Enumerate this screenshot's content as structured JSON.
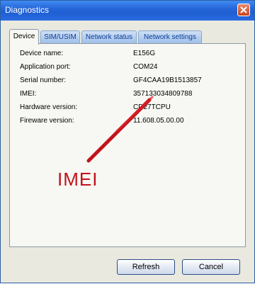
{
  "window": {
    "title": "Diagnostics"
  },
  "tabs": [
    {
      "label": "Device"
    },
    {
      "label": "SIM/USIM"
    },
    {
      "label": "Network status"
    },
    {
      "label": "Network settings"
    }
  ],
  "device": [
    {
      "label": "Device name:",
      "value": "E156G"
    },
    {
      "label": "Application port:",
      "value": "COM24"
    },
    {
      "label": "Serial number:",
      "value": "GF4CAA19B1513857"
    },
    {
      "label": "IMEI:",
      "value": "357133034809788"
    },
    {
      "label": "Hardware version:",
      "value": "CD27TCPU"
    },
    {
      "label": "Fireware version:",
      "value": "11.608.05.00.00"
    }
  ],
  "annotation": {
    "text": "IMEI",
    "color": "#c1131b"
  },
  "buttons": {
    "refresh": "Refresh",
    "cancel": "Cancel"
  }
}
